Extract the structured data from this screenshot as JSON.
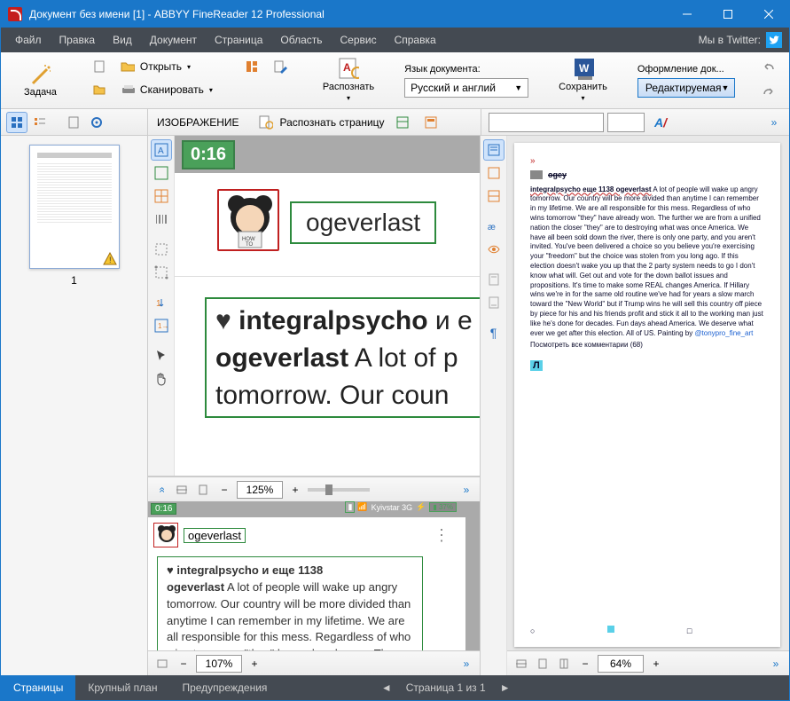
{
  "window": {
    "title": "Документ без имени [1] - ABBYY FineReader 12 Professional"
  },
  "menu": {
    "items": [
      "Файл",
      "Правка",
      "Вид",
      "Документ",
      "Страница",
      "Область",
      "Сервис",
      "Справка"
    ],
    "twitter": "Мы в Twitter:"
  },
  "ribbon": {
    "task": "Задача",
    "open": "Открыть",
    "scan": "Сканировать",
    "read": "Распознать",
    "lang_label": "Язык документа:",
    "lang_value": "Русский и англий",
    "save": "Сохранить",
    "layout_label": "Оформление док...",
    "layout_value": "Редактируемая"
  },
  "toolbar2": {
    "image_label": "ИЗОБРАЖЕНИЕ",
    "read_page": "Распознать страницу"
  },
  "pages": {
    "current_label": "1"
  },
  "image": {
    "time_badge": "0:16",
    "username": "ogeverlast",
    "big_line1_prefix": "integralpsycho",
    "big_line1_rest": " и е",
    "big_line2_bold": "ogeverlast",
    "big_line2_rest": " A lot of p",
    "big_line3": "tomorrow. Our coun"
  },
  "image_zoom": {
    "value": "125%"
  },
  "detail": {
    "time_badge": "0:16",
    "carrier": "Kyivstar 3G",
    "battery": "37%",
    "username": "ogeverlast",
    "bold1": "integralpsycho и еще 1138",
    "bold2": "ogeverlast",
    "body": " A lot of people will wake up angry tomorrow. Our country will be more divided than anytime I can remember in my lifetime. We are all responsible for this mess. Regardless of who wins tomorrow \"they\" have already won. The further we are"
  },
  "detail_zoom": {
    "value": "107%"
  },
  "right": {
    "ogey": "ogey",
    "head": "integralpsycho еще 1138 ogeverlast",
    "body": " A lot of people will wake up angry tomorrow. Our country will be more divided than anytime I can remember in my lifetime. We are all responsible for this mess. Regardless of who wins tomorrow \"they\" have already won. The further we are from a unified nation the closer \"they\" are to destroying what was once America. We have all been sold down the river, there is only one party, and you aren't invited. You've been delivered a choice so you believe you're exercising your \"freedom\" but the choice was stolen from you long ago. If this election doesn't wake you up that the 2 party system needs to go I don't know what will. Get out and vote for the down ballot issues and propositions. It's time to make some REAL changes America. If Hillary wins we're in for the same old routine we've had for years a slow march toward the \"New World\" but if Trump wins he will sell this country off piece by piece for his and his friends profit and stick it all to the working man just like he's done for decades. Fun days ahead America. We deserve what ever we get after this election. All of US. Painting by ",
    "link": "@tonypro_fine_art",
    "comments": "Посмотреть все комментарии (68)",
    "badge": "Л"
  },
  "right_zoom": {
    "value": "64%"
  },
  "status": {
    "tab_pages": "Страницы",
    "tab_zoom": "Крупный план",
    "tab_warn": "Предупреждения",
    "page_info": "Страница 1 из 1"
  }
}
